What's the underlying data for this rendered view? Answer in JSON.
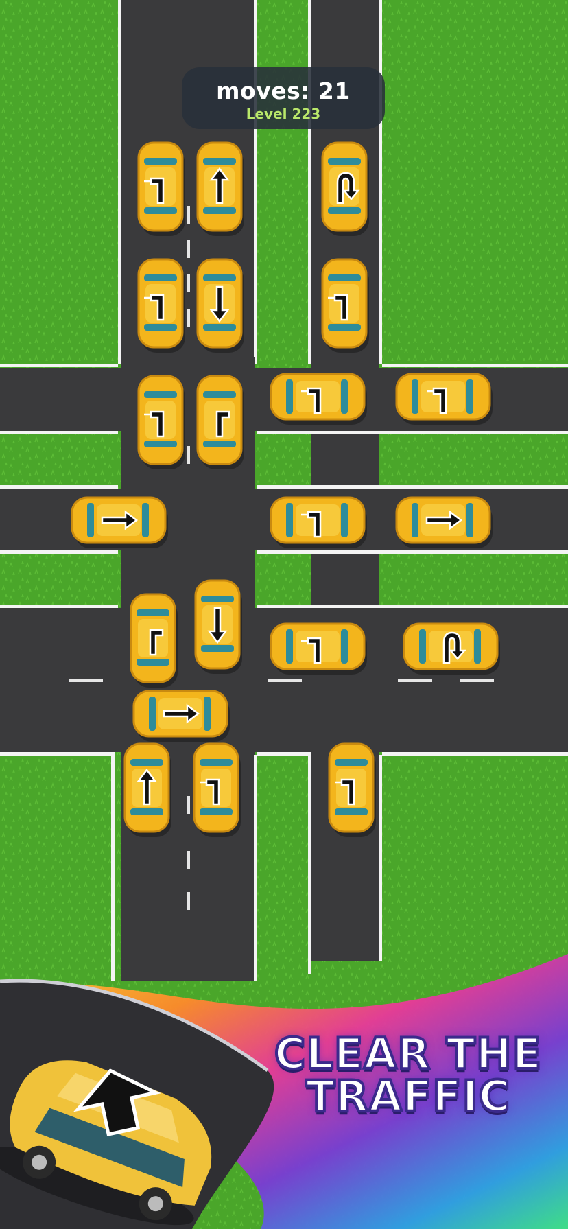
{
  "hud": {
    "moves_label": "moves",
    "moves_value": "21",
    "level": "Level 223"
  },
  "promo": {
    "line1": "CLEAR THE",
    "line2": "TRAFFIC"
  },
  "colors": {
    "grass": "#4aa62a",
    "road": "#3a3a3c",
    "car_body": "#f3b51c",
    "car_window": "#2e8c9a",
    "hud_bg": "#28303a",
    "level_text": "#b9e86a"
  },
  "cars": [
    {
      "id": "car-1",
      "arrow": "turn-left-icon",
      "heading": "up"
    },
    {
      "id": "car-2",
      "arrow": "up-arrow-icon",
      "heading": "up"
    },
    {
      "id": "car-3",
      "arrow": "u-turn-icon",
      "heading": "up"
    },
    {
      "id": "car-4",
      "arrow": "turn-left-icon",
      "heading": "down"
    },
    {
      "id": "car-5",
      "arrow": "down-arrow-icon",
      "heading": "down"
    },
    {
      "id": "car-6",
      "arrow": "turn-left-icon",
      "heading": "down"
    },
    {
      "id": "car-7",
      "arrow": "turn-left-icon",
      "heading": "down"
    },
    {
      "id": "car-8",
      "arrow": "turn-right-icon",
      "heading": "down"
    },
    {
      "id": "car-9",
      "arrow": "turn-left-icon",
      "heading": "left"
    },
    {
      "id": "car-10",
      "arrow": "turn-left-icon",
      "heading": "left"
    },
    {
      "id": "car-11",
      "arrow": "right-arrow-icon",
      "heading": "right"
    },
    {
      "id": "car-12",
      "arrow": "turn-left-icon",
      "heading": "left"
    },
    {
      "id": "car-13",
      "arrow": "right-arrow-icon",
      "heading": "right"
    },
    {
      "id": "car-14",
      "arrow": "turn-right-icon",
      "heading": "up"
    },
    {
      "id": "car-15",
      "arrow": "down-arrow-icon",
      "heading": "down"
    },
    {
      "id": "car-16",
      "arrow": "turn-left-icon",
      "heading": "left"
    },
    {
      "id": "car-17",
      "arrow": "u-turn-icon",
      "heading": "right"
    },
    {
      "id": "car-18",
      "arrow": "right-arrow-icon",
      "heading": "right"
    },
    {
      "id": "car-19",
      "arrow": "up-arrow-icon",
      "heading": "up"
    },
    {
      "id": "car-20",
      "arrow": "turn-left-icon",
      "heading": "up"
    },
    {
      "id": "car-21",
      "arrow": "turn-left-icon",
      "heading": "up"
    }
  ]
}
